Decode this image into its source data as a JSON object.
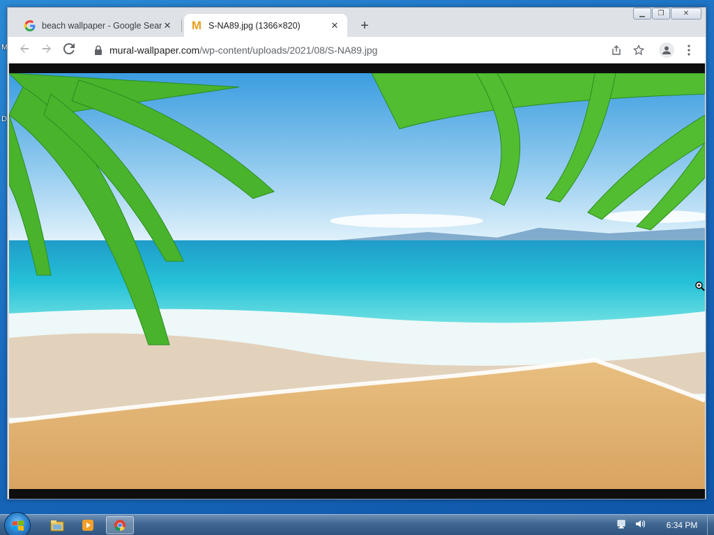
{
  "desktop": {
    "edge_letters": [
      "M",
      "D"
    ]
  },
  "browser": {
    "tabs": [
      {
        "title": "beach wallpaper - Google Search",
        "favicon": "google-g-icon",
        "active": false
      },
      {
        "title": "S-NA89.jpg (1366×820)",
        "favicon": "mural-m-icon",
        "favicon_text": "M",
        "active": true
      }
    ],
    "new_tab_label": "+",
    "url_host": "mural-wallpaper.com",
    "url_path": "/wp-content/uploads/2021/08/S-NA89.jpg",
    "content": {
      "image_description_icon": "beach-palm-photo"
    }
  },
  "taskbar": {
    "apps": [
      "explorer-icon",
      "media-player-icon",
      "chrome-icon"
    ],
    "time": "6:34 PM"
  },
  "colors": {
    "accent": "#1a73e8",
    "tab_active_bg": "#ffffff",
    "chrome_frame": "#dee1e6"
  }
}
